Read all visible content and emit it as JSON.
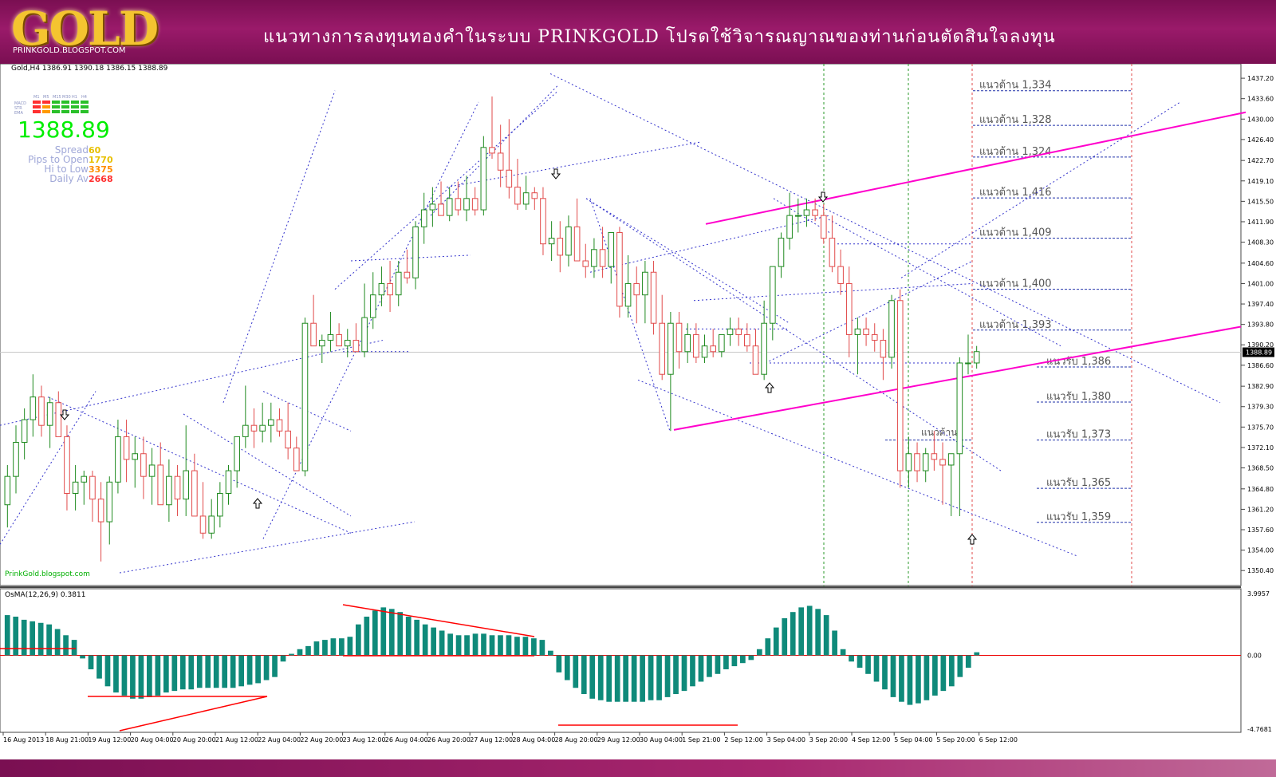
{
  "banner": {
    "logo_text": "GOLD",
    "logo_sub": "PRINKGOLD.BLOGSPOT.COM",
    "title": "แนวทางการลงทุนทองคำในระบบ   PRINKGOLD    โปรดใช้วิจารณญาณของท่านก่อนตัดสินใจลงทุน"
  },
  "chart_header": "Gold,H4  1386.91 1390.18 1386.15 1388.89",
  "watermark": "PrinkGold.blogspot.com",
  "panel": {
    "tf_labels": [
      "M1",
      "M5",
      "M15",
      "M30",
      "H1",
      "H4"
    ],
    "row_labels": [
      "MACD",
      "STR",
      "EMA"
    ],
    "price": "1388.89",
    "stats": [
      {
        "label": "Spread",
        "value": "60",
        "color": "#e8c000"
      },
      {
        "label": "Pips to Open",
        "value": "1770",
        "color": "#e8c000"
      },
      {
        "label": "Hi to Low",
        "value": "3375",
        "color": "#ff8c00"
      },
      {
        "label": "Daily Av",
        "value": "2668",
        "color": "#ff3030"
      }
    ]
  },
  "osma_label": "OsMA(12,26,9) 0.3811",
  "colors": {
    "bull": "#1f8a1f",
    "bear": "#e14a4a",
    "channel": "#ff00cc",
    "trend": "#3333cc",
    "osma": "#0f8a7a",
    "osma_line": "#ff0000",
    "support": "#2233aa"
  },
  "chart_data": {
    "type": "candlestick",
    "symbol": "Gold",
    "timeframe": "H4",
    "ylim": [
      1348.6,
      1438.9
    ],
    "y_ticks": [
      "1437.20",
      "1433.60",
      "1430.00",
      "1426.40",
      "1422.70",
      "1419.10",
      "1415.50",
      "1411.90",
      "1408.30",
      "1404.60",
      "1401.00",
      "1397.40",
      "1393.80",
      "1390.20",
      "1386.60",
      "1382.90",
      "1379.30",
      "1375.70",
      "1372.10",
      "1368.50",
      "1364.80",
      "1361.20",
      "1357.60",
      "1354.00",
      "1350.40"
    ],
    "current_price": "1388.89",
    "x_ticks": [
      "16 Aug 2013",
      "18 Aug 21:00",
      "19 Aug 12:00",
      "20 Aug 04:00",
      "20 Aug 20:00",
      "21 Aug 12:00",
      "22 Aug 04:00",
      "22 Aug 20:00",
      "23 Aug 12:00",
      "26 Aug 04:00",
      "26 Aug 20:00",
      "27 Aug 12:00",
      "28 Aug 04:00",
      "28 Aug 20:00",
      "29 Aug 12:00",
      "30 Aug 04:00",
      "1 Sep 21:00",
      "2 Sep 12:00",
      "3 Sep 04:00",
      "3 Sep 20:00",
      "4 Sep 12:00",
      "5 Sep 04:00",
      "5 Sep 20:00",
      "6 Sep 12:00"
    ],
    "candles": [
      [
        1362,
        1369,
        1358,
        1367
      ],
      [
        1367,
        1376,
        1364,
        1373
      ],
      [
        1373,
        1379,
        1370,
        1377
      ],
      [
        1377,
        1385,
        1374,
        1381
      ],
      [
        1381,
        1383,
        1374,
        1376
      ],
      [
        1376,
        1381,
        1372,
        1380
      ],
      [
        1380,
        1382,
        1375,
        1374
      ],
      [
        1374,
        1376,
        1361,
        1364
      ],
      [
        1364,
        1369,
        1361,
        1366
      ],
      [
        1366,
        1368,
        1362,
        1367
      ],
      [
        1367,
        1368,
        1359,
        1363
      ],
      [
        1363,
        1366,
        1352,
        1359
      ],
      [
        1359,
        1367,
        1355,
        1366
      ],
      [
        1366,
        1377,
        1364,
        1374
      ],
      [
        1374,
        1377,
        1366,
        1370
      ],
      [
        1370,
        1374,
        1365,
        1371
      ],
      [
        1371,
        1374,
        1363,
        1367
      ],
      [
        1367,
        1372,
        1362,
        1369
      ],
      [
        1369,
        1373,
        1363,
        1362
      ],
      [
        1362,
        1370,
        1359,
        1367
      ],
      [
        1367,
        1369,
        1360,
        1363
      ],
      [
        1363,
        1376,
        1360,
        1368
      ],
      [
        1368,
        1371,
        1362,
        1360
      ],
      [
        1360,
        1366,
        1356,
        1357
      ],
      [
        1357,
        1363,
        1356,
        1360
      ],
      [
        1360,
        1366,
        1358,
        1364
      ],
      [
        1364,
        1369,
        1362,
        1368
      ],
      [
        1368,
        1373,
        1365,
        1374
      ],
      [
        1374,
        1383,
        1372,
        1376
      ],
      [
        1376,
        1379,
        1372,
        1375
      ],
      [
        1375,
        1380,
        1373,
        1376
      ],
      [
        1376,
        1380,
        1373,
        1377
      ],
      [
        1377,
        1379,
        1374,
        1375
      ],
      [
        1375,
        1380,
        1370,
        1372
      ],
      [
        1372,
        1374,
        1368,
        1368
      ],
      [
        1368,
        1395,
        1367,
        1394
      ],
      [
        1394,
        1399,
        1391,
        1390
      ],
      [
        1390,
        1392,
        1387,
        1391
      ],
      [
        1391,
        1396,
        1389,
        1392
      ],
      [
        1392,
        1394,
        1390,
        1390
      ],
      [
        1390,
        1393,
        1388,
        1391
      ],
      [
        1391,
        1394,
        1389,
        1389
      ],
      [
        1389,
        1401,
        1388,
        1395
      ],
      [
        1395,
        1403,
        1393,
        1399
      ],
      [
        1399,
        1404,
        1397,
        1401
      ],
      [
        1401,
        1405,
        1396,
        1399
      ],
      [
        1399,
        1405,
        1397,
        1403
      ],
      [
        1403,
        1407,
        1401,
        1402
      ],
      [
        1402,
        1412,
        1400,
        1411
      ],
      [
        1411,
        1417,
        1408,
        1414
      ],
      [
        1414,
        1418,
        1411,
        1415
      ],
      [
        1415,
        1419,
        1413,
        1413
      ],
      [
        1413,
        1418,
        1412,
        1416
      ],
      [
        1416,
        1419,
        1413,
        1414
      ],
      [
        1414,
        1420,
        1412,
        1416
      ],
      [
        1416,
        1418,
        1413,
        1414
      ],
      [
        1414,
        1427,
        1413,
        1425
      ],
      [
        1425,
        1434,
        1423,
        1424
      ],
      [
        1424,
        1429,
        1418,
        1421
      ],
      [
        1421,
        1430,
        1416,
        1418
      ],
      [
        1418,
        1423,
        1414,
        1415
      ],
      [
        1415,
        1420,
        1414,
        1417
      ],
      [
        1417,
        1418,
        1414,
        1416
      ],
      [
        1416,
        1418,
        1406,
        1408
      ],
      [
        1408,
        1412,
        1405,
        1409
      ],
      [
        1409,
        1412,
        1403,
        1406
      ],
      [
        1406,
        1413,
        1404,
        1411
      ],
      [
        1411,
        1416,
        1407,
        1405
      ],
      [
        1405,
        1408,
        1402,
        1404
      ],
      [
        1404,
        1409,
        1402,
        1407
      ],
      [
        1407,
        1411,
        1402,
        1404
      ],
      [
        1404,
        1410,
        1401,
        1410
      ],
      [
        1410,
        1411,
        1395,
        1397
      ],
      [
        1397,
        1406,
        1395,
        1401
      ],
      [
        1401,
        1404,
        1394,
        1399
      ],
      [
        1399,
        1405,
        1394,
        1403
      ],
      [
        1403,
        1405,
        1392,
        1394
      ],
      [
        1394,
        1399,
        1384,
        1385
      ],
      [
        1385,
        1396,
        1375,
        1394
      ],
      [
        1394,
        1396,
        1386,
        1389
      ],
      [
        1389,
        1394,
        1387,
        1392
      ],
      [
        1392,
        1394,
        1387,
        1388
      ],
      [
        1388,
        1392,
        1387,
        1390
      ],
      [
        1390,
        1393,
        1388,
        1389
      ],
      [
        1389,
        1392,
        1388,
        1392
      ],
      [
        1392,
        1395,
        1390,
        1393
      ],
      [
        1393,
        1395,
        1390,
        1392
      ],
      [
        1392,
        1394,
        1389,
        1390
      ],
      [
        1390,
        1393,
        1387,
        1385
      ],
      [
        1385,
        1398,
        1384,
        1394
      ],
      [
        1394,
        1404,
        1391,
        1404
      ],
      [
        1404,
        1410,
        1402,
        1409
      ],
      [
        1409,
        1417,
        1407,
        1413
      ],
      [
        1413,
        1416,
        1410,
        1413
      ],
      [
        1413,
        1416,
        1411,
        1414
      ],
      [
        1414,
        1416,
        1412,
        1413
      ],
      [
        1413,
        1415,
        1408,
        1409
      ],
      [
        1409,
        1413,
        1403,
        1404
      ],
      [
        1404,
        1407,
        1399,
        1401
      ],
      [
        1401,
        1404,
        1388,
        1392
      ],
      [
        1392,
        1395,
        1385,
        1393
      ],
      [
        1393,
        1395,
        1390,
        1392
      ],
      [
        1392,
        1394,
        1389,
        1391
      ],
      [
        1391,
        1393,
        1384,
        1388
      ],
      [
        1388,
        1399,
        1386,
        1398
      ],
      [
        1398,
        1400,
        1365,
        1368
      ],
      [
        1368,
        1374,
        1365,
        1371
      ],
      [
        1371,
        1373,
        1366,
        1368
      ],
      [
        1368,
        1372,
        1366,
        1371
      ],
      [
        1371,
        1375,
        1368,
        1370
      ],
      [
        1370,
        1373,
        1362,
        1369
      ],
      [
        1369,
        1371,
        1360,
        1371
      ],
      [
        1371,
        1388,
        1360,
        1387
      ],
      [
        1387,
        1392,
        1385,
        1387
      ],
      [
        1387,
        1390,
        1386,
        1389
      ]
    ],
    "levels": [
      {
        "label": "แนวต้าน 1,334",
        "value": 1435.0
      },
      {
        "label": "แนวต้าน 1,328",
        "value": 1428.9
      },
      {
        "label": "แนวต้าน 1,324",
        "value": 1423.3
      },
      {
        "label": "แนวต้าน 1,416",
        "value": 1416.1
      },
      {
        "label": "แนวต้าน 1,409",
        "value": 1409.0
      },
      {
        "label": "แนวต้าน 1,400",
        "value": 1400.0
      },
      {
        "label": "แนวต้าน 1,393",
        "value": 1392.8
      },
      {
        "label": "แนวรับ 1,386",
        "value": 1386.3
      },
      {
        "label": "แนวรับ 1,380",
        "value": 1380.1
      },
      {
        "label": "แนวรับ 1,373",
        "value": 1373.4
      },
      {
        "label": "แนวรับ 1,365",
        "value": 1364.9
      },
      {
        "label": "แนวรับ 1,359",
        "value": 1358.9
      }
    ],
    "annotation_resistance": "แนวต้าน",
    "osma": {
      "ylim": [
        -4.7681,
        3.9957
      ],
      "tick_labels": [
        "3.9957",
        "0.00",
        "-4.7681"
      ],
      "values": [
        2.6,
        2.5,
        2.3,
        2.2,
        2.1,
        2.0,
        1.7,
        1.3,
        1.0,
        -0.2,
        -0.9,
        -1.5,
        -2.0,
        -2.4,
        -2.6,
        -2.8,
        -2.8,
        -2.7,
        -2.6,
        -2.4,
        -2.3,
        -2.2,
        -2.2,
        -2.1,
        -2.1,
        -2.1,
        -2.1,
        -2.1,
        -2.0,
        -1.9,
        -1.8,
        -1.6,
        -1.4,
        -0.4,
        0.1,
        0.4,
        0.6,
        0.9,
        1.0,
        1.1,
        1.1,
        1.2,
        2.0,
        2.5,
        2.9,
        3.1,
        3.0,
        2.8,
        2.5,
        2.3,
        2.0,
        1.8,
        1.6,
        1.4,
        1.3,
        1.3,
        1.4,
        1.4,
        1.3,
        1.3,
        1.3,
        1.2,
        1.2,
        1.1,
        1.0,
        0.3,
        -1.1,
        -1.6,
        -2.1,
        -2.5,
        -2.8,
        -2.9,
        -3.0,
        -3.0,
        -3.0,
        -3.0,
        -3.0,
        -2.9,
        -2.9,
        -2.7,
        -2.5,
        -2.3,
        -2.0,
        -1.7,
        -1.4,
        -1.2,
        -0.9,
        -0.7,
        -0.5,
        -0.3,
        0.4,
        1.1,
        1.8,
        2.4,
        2.8,
        3.1,
        3.2,
        3.0,
        2.6,
        1.6,
        0.4,
        -0.4,
        -0.8,
        -1.2,
        -1.7,
        -2.2,
        -2.7,
        -3.0,
        -3.2,
        -3.1,
        -2.9,
        -2.6,
        -2.3,
        -2.0,
        -1.4,
        -0.8,
        0.2
      ]
    }
  }
}
